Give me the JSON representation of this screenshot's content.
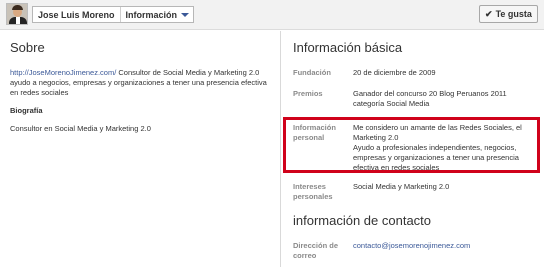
{
  "header": {
    "page_name": "Jose Luis Moreno",
    "section_label": "Información",
    "like_button": "Te gusta",
    "like_check": "✔"
  },
  "about": {
    "title": "Sobre",
    "link_text": "http://JoseMorenoJimenez.com/",
    "description": " Consultor de Social Media y Marketing 2.0 ayudo a negocios, empresas y organizaciones a tener una presencia efectiva en redes sociales",
    "bio_heading": "Biografía",
    "bio_text": "Consultor en Social Media y Marketing 2.0"
  },
  "basic_info": {
    "title": "Información básica",
    "rows": [
      {
        "label": "Fundación",
        "value": "20 de diciembre de 2009"
      },
      {
        "label": "Premios",
        "value": "Ganador del concurso 20 Blog Peruanos 2011 categoría Social Media"
      },
      {
        "label": "Información personal",
        "value": "Me considero un amante de las Redes Sociales, el Marketing 2.0\nAyudo a profesionales independientes, negocios, empresas y organizaciones a tener una presencia efectiva en redes sociales"
      },
      {
        "label": "Intereses personales",
        "value": "Social Media y Marketing 2.0"
      }
    ]
  },
  "contact": {
    "title": "información de contacto",
    "email_label": "Dirección de correo",
    "email_value": "contacto@josemorenojimenez.com"
  },
  "colors": {
    "highlight": "#d0021b",
    "link": "#3b5998"
  }
}
